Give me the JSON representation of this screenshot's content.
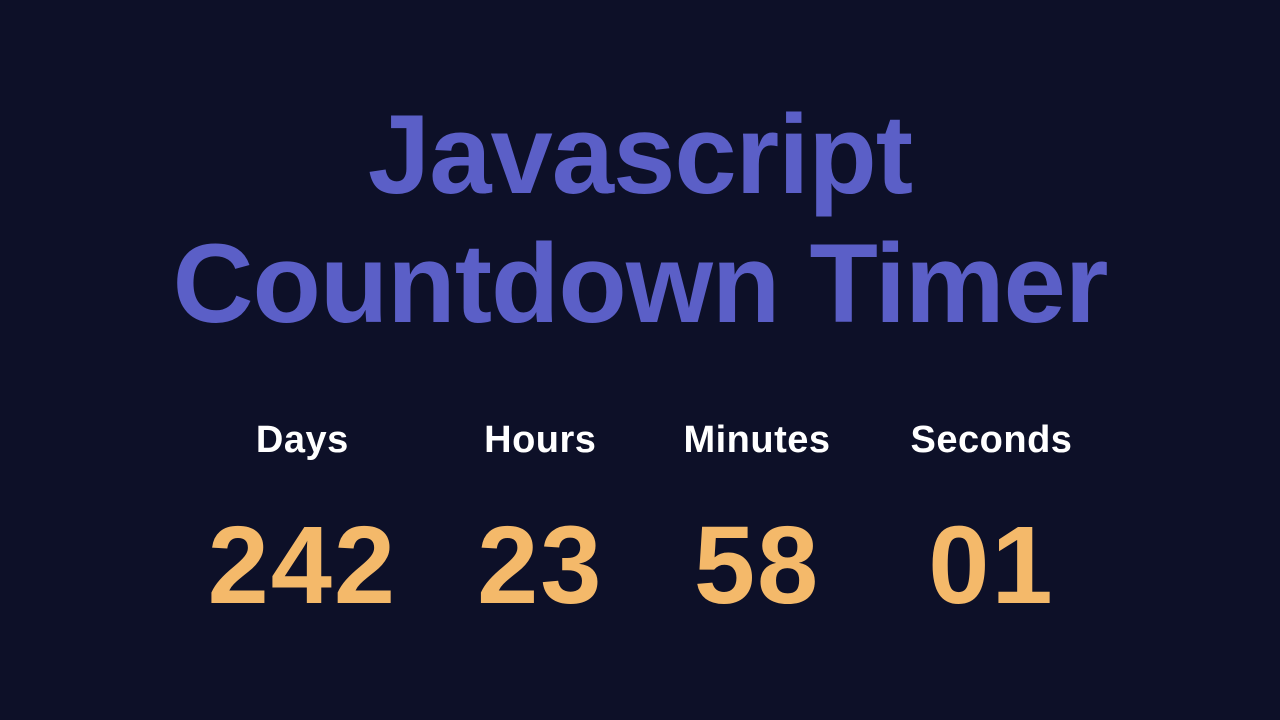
{
  "title": {
    "line1": "Javascript",
    "line2": "Countdown Timer"
  },
  "timer": {
    "units": [
      {
        "label": "Days",
        "value": "242"
      },
      {
        "label": "Hours",
        "value": "23"
      },
      {
        "label": "Minutes",
        "value": "58"
      },
      {
        "label": "Seconds",
        "value": "01"
      }
    ]
  },
  "colors": {
    "background": "#0d1028",
    "title": "#5b5fc7",
    "label": "#ffffff",
    "value": "#f4b96a"
  }
}
